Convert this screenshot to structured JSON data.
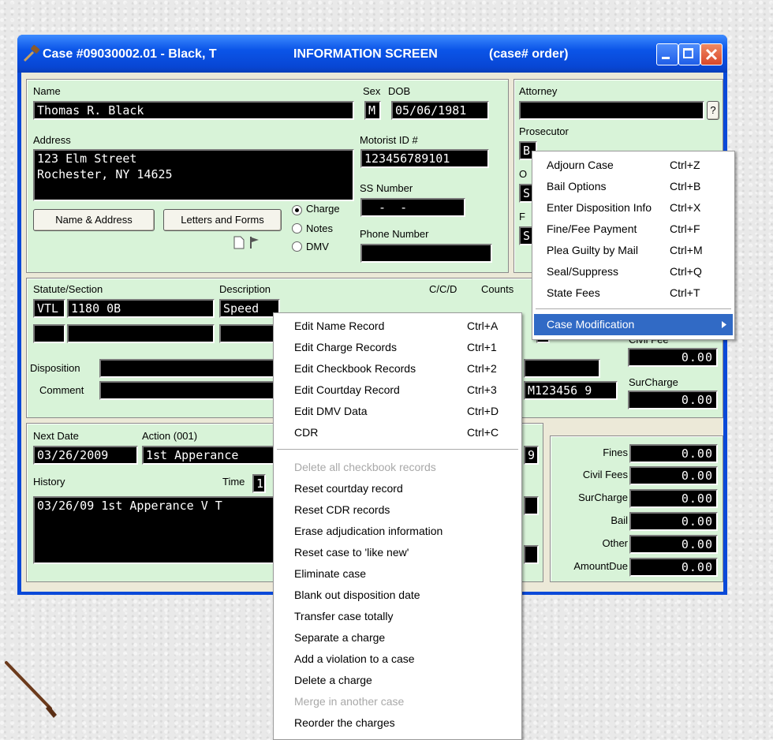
{
  "window": {
    "title": "Case #09030002.01 - Black, T",
    "subtitle": "INFORMATION SCREEN",
    "order": "(case# order)"
  },
  "person": {
    "name_label": "Name",
    "name": "Thomas R. Black",
    "sex_label": "Sex",
    "sex": "M",
    "dob_label": "DOB",
    "dob": "05/06/1981",
    "address_label": "Address",
    "address_line1": "123 Elm Street",
    "address_line2": "Rochester, NY 14625",
    "motorist_label": "Motorist ID #",
    "motorist_id": "123456789101",
    "ss_label": "SS Number",
    "ss_number": "  -  -",
    "phone_label": "Phone Number",
    "phone": "",
    "name_address_btn": "Name & Address",
    "letters_btn": "Letters and Forms",
    "radios": [
      "Charge",
      "Notes",
      "DMV"
    ],
    "radio_selected": "Charge"
  },
  "right_panel": {
    "attorney_label": "Attorney",
    "attorney": "",
    "attorney_btn": "?",
    "prosecutor_label": "Prosecutor",
    "prosecutor_value": "B",
    "o_label": "O",
    "o_value": "S",
    "f_label": "F",
    "f_value": "S"
  },
  "charge": {
    "statute_label": "Statute/Section",
    "description_label": "Description",
    "ccd_label": "C/C/D",
    "counts_label": "Counts",
    "code": "VTL",
    "statute": "1180 0B",
    "description": "Speed",
    "disposition_label": "Disposition",
    "comment_label": "Comment",
    "civil_fee_label": "Civil Fee",
    "civil_fee": "0.00",
    "surcharge_label": "SurCharge",
    "surcharge": "0.00",
    "ticket": "M123456 9"
  },
  "schedule": {
    "next_date_label": "Next Date",
    "next_date": "03/26/2009",
    "action_label": "Action (001)",
    "action": "1st Apperance",
    "history_label": "History",
    "time_label": "Time",
    "time_value": "1",
    "history_text": "03/26/09 1st Apperance V T",
    "right_digit": "9"
  },
  "totals": {
    "rows": [
      {
        "label": "Fines",
        "value": "0.00"
      },
      {
        "label": "Civil Fees",
        "value": "0.00"
      },
      {
        "label": "SurCharge",
        "value": "0.00"
      },
      {
        "label": "Bail",
        "value": "0.00"
      },
      {
        "label": "Other",
        "value": "0.00"
      },
      {
        "label": "AmountDue",
        "value": "0.00"
      }
    ]
  },
  "main_menu": {
    "items": [
      {
        "label": "Adjourn Case",
        "shortcut": "Ctrl+Z"
      },
      {
        "label": "Bail Options",
        "shortcut": "Ctrl+B"
      },
      {
        "label": "Enter Disposition Info",
        "shortcut": "Ctrl+X"
      },
      {
        "label": "Fine/Fee Payment",
        "shortcut": "Ctrl+F"
      },
      {
        "label": "Plea Guilty by Mail",
        "shortcut": "Ctrl+M"
      },
      {
        "label": "Seal/Suppress",
        "shortcut": "Ctrl+Q"
      },
      {
        "label": "State Fees",
        "shortcut": "Ctrl+T"
      }
    ],
    "submenu_label": "Case Modification"
  },
  "sub_menu": {
    "items": [
      {
        "label": "Edit Name Record",
        "shortcut": "Ctrl+A"
      },
      {
        "label": "Edit Charge Records",
        "shortcut": "Ctrl+1"
      },
      {
        "label": "Edit Checkbook Records",
        "shortcut": "Ctrl+2"
      },
      {
        "label": "Edit Courtday Record",
        "shortcut": "Ctrl+3"
      },
      {
        "label": "Edit DMV Data",
        "shortcut": "Ctrl+D"
      },
      {
        "label": "CDR",
        "shortcut": "Ctrl+C"
      }
    ],
    "items2": [
      {
        "label": "Delete all checkbook records",
        "disabled": true
      },
      {
        "label": "Reset courtday record"
      },
      {
        "label": "Reset CDR records"
      },
      {
        "label": "Erase adjudication information"
      },
      {
        "label": "Reset case to 'like new'"
      },
      {
        "label": "Eliminate case"
      },
      {
        "label": "Blank out disposition date"
      },
      {
        "label": "Transfer case totally"
      },
      {
        "label": "Separate a charge"
      },
      {
        "label": "Add a violation to a case"
      },
      {
        "label": "Delete a charge"
      },
      {
        "label": "Merge in another case",
        "disabled": true
      },
      {
        "label": "Reorder the charges"
      }
    ]
  }
}
